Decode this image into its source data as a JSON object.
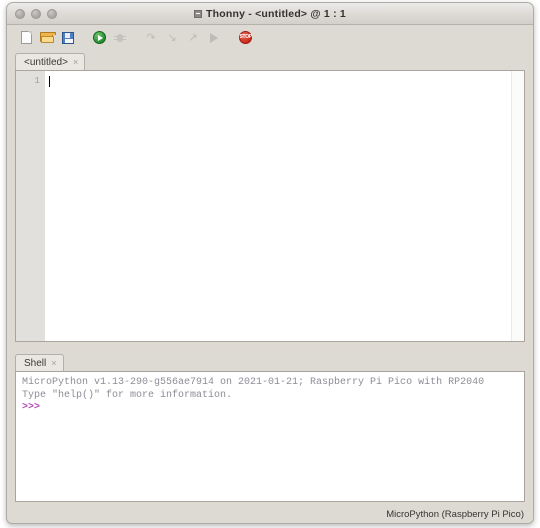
{
  "window": {
    "title": "Thonny  -  <untitled>  @  1 : 1",
    "app_icon": "thonny-app-icon",
    "controls": [
      "close-button",
      "minimize-button",
      "zoom-button"
    ]
  },
  "toolbar": {
    "buttons": [
      {
        "name": "new-file-button",
        "icon": "new-file-icon",
        "enabled": true
      },
      {
        "name": "open-file-button",
        "icon": "open-folder-icon",
        "enabled": true
      },
      {
        "name": "save-file-button",
        "icon": "save-floppy-icon",
        "enabled": true
      },
      {
        "name": "run-button",
        "icon": "run-play-icon",
        "enabled": true
      },
      {
        "name": "debug-button",
        "icon": "debug-bug-icon",
        "enabled": false
      },
      {
        "name": "step-over-button",
        "icon": "step-over-icon",
        "enabled": false
      },
      {
        "name": "step-into-button",
        "icon": "step-into-icon",
        "enabled": false
      },
      {
        "name": "step-out-button",
        "icon": "step-out-icon",
        "enabled": false
      },
      {
        "name": "resume-button",
        "icon": "resume-icon",
        "enabled": false
      },
      {
        "name": "stop-button",
        "icon": "stop-sign-icon",
        "enabled": true
      }
    ],
    "step_over_glyph": "↷",
    "step_into_glyph": "↘",
    "step_out_glyph": "↗",
    "stop_label": "STOP"
  },
  "editor": {
    "tab": {
      "label": "<untitled>",
      "close_glyph": "×"
    },
    "line_numbers": [
      "1"
    ],
    "lines": [
      ""
    ],
    "cursor_position": "1 : 1"
  },
  "shell": {
    "tab": {
      "label": "Shell",
      "close_glyph": "×"
    },
    "banner_line_1": "MicroPython v1.13-290-g556ae7914 on 2021-01-21; Raspberry Pi Pico with RP2040",
    "banner_line_2": "Type \"help()\" for more information.",
    "prompt": ">>>"
  },
  "status_bar": {
    "interpreter": "MicroPython (Raspberry Pi Pico)"
  },
  "colors": {
    "window_chrome": "#ddd9d3",
    "panel_background": "#ffffff",
    "shell_text": "#8f8d97",
    "prompt_magenta": "#b047b0",
    "run_green": "#1f8a2e",
    "stop_red": "#cc2a1c",
    "folder_orange": "#f0b44a",
    "save_blue": "#4f7fc4"
  }
}
